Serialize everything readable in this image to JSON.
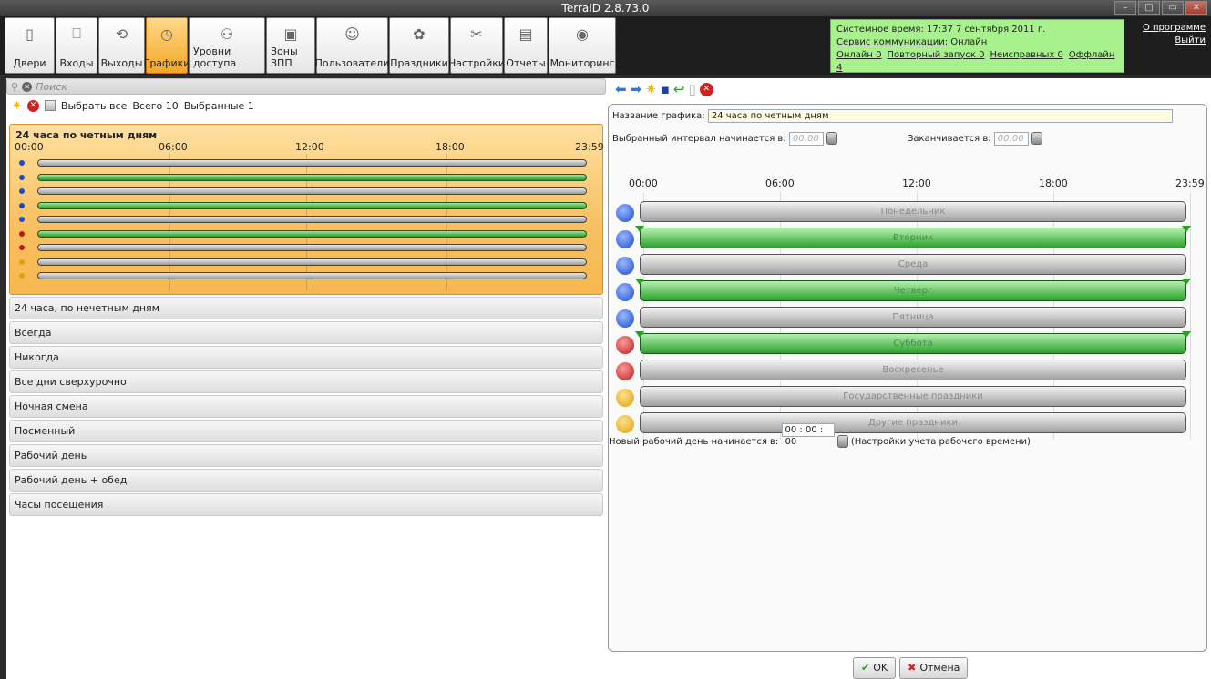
{
  "window": {
    "title": "TerraID 2.8.73.0",
    "controls": [
      "–",
      "□",
      "▭",
      "✕"
    ]
  },
  "toolbar": {
    "items": [
      {
        "label": "Двери",
        "icon": "door-icon",
        "glyph": "▯"
      },
      {
        "label": "Входы",
        "icon": "entrance-icon",
        "glyph": "⎕"
      },
      {
        "label": "Выходы",
        "icon": "exit-icon",
        "glyph": "⟲"
      },
      {
        "label": "Графики",
        "icon": "clock-icon",
        "glyph": "◷"
      },
      {
        "label": "Уровни доступа",
        "icon": "access-levels-icon",
        "glyph": "⚇"
      },
      {
        "label": "Зоны ЗПП",
        "icon": "zones-icon",
        "glyph": "▣"
      },
      {
        "label": "Пользователи",
        "icon": "users-icon",
        "glyph": "☺"
      },
      {
        "label": "Праздники",
        "icon": "holidays-icon",
        "glyph": "✿"
      },
      {
        "label": "Настройки",
        "icon": "settings-icon",
        "glyph": "✂"
      },
      {
        "label": "Отчеты",
        "icon": "reports-icon",
        "glyph": "▤"
      },
      {
        "label": "Мониторинг",
        "icon": "eye-icon",
        "glyph": "◉"
      }
    ]
  },
  "status": {
    "system_time": "Системное время: 17:37 7 сентября 2011 г.",
    "comm_service_label": "Сервис коммуникации:",
    "comm_service_value": "Онлайн",
    "online": "Онлайн 0",
    "restart": "Повторный запуск 0",
    "faulty": "Неисправных 0",
    "offline": "Оффлайн 4"
  },
  "toplinks": {
    "about": "О программе",
    "logout": "Выйти"
  },
  "left": {
    "search_placeholder": "Поиск",
    "select_all": "Выбрать все",
    "total": "Всего 10",
    "selected": "Выбранные 1",
    "selected_item": {
      "title": "24 часа по четным дням",
      "ticks": [
        "00:00",
        "06:00",
        "12:00",
        "18:00",
        "23:59"
      ]
    },
    "items": [
      "24 часа, по нечетным дням",
      "Всегда",
      "Никогда",
      "Все дни сверхурочно",
      "Ночная смена",
      "Посменный",
      "Рабочий день",
      "Рабочий день + обед",
      "Часы посещения"
    ]
  },
  "right": {
    "name_label": "Название графика:",
    "name_value": "24 часа по четным дням",
    "interval_start_label": "Выбранный интервал начинается в:",
    "interval_start_value": "00:00",
    "interval_end_label": "Заканчивается в:",
    "interval_end_value": "00:00",
    "ticks": [
      "00:00",
      "06:00",
      "12:00",
      "18:00",
      "23:59"
    ],
    "days": [
      {
        "label": "Понедельник",
        "active": false,
        "color": "#1a4ad0"
      },
      {
        "label": "Вторник",
        "active": true,
        "color": "#1a4ad0"
      },
      {
        "label": "Среда",
        "active": false,
        "color": "#1a4ad0"
      },
      {
        "label": "Четверг",
        "active": true,
        "color": "#1a4ad0"
      },
      {
        "label": "Пятница",
        "active": false,
        "color": "#1a4ad0"
      },
      {
        "label": "Суббота",
        "active": true,
        "color": "#c01818"
      },
      {
        "label": "Воскресенье",
        "active": false,
        "color": "#c01818"
      },
      {
        "label": "Государственные праздники",
        "active": false,
        "color": "#e0a010"
      },
      {
        "label": "Другие праздники",
        "active": false,
        "color": "#e0a010"
      }
    ],
    "workday_label": "Новый рабочий день начинается в:",
    "workday_value": "00 : 00 : 00",
    "workday_note": "(Настройки учета рабочего времени)"
  },
  "buttons": {
    "ok": "OK",
    "cancel": "Отмена"
  }
}
